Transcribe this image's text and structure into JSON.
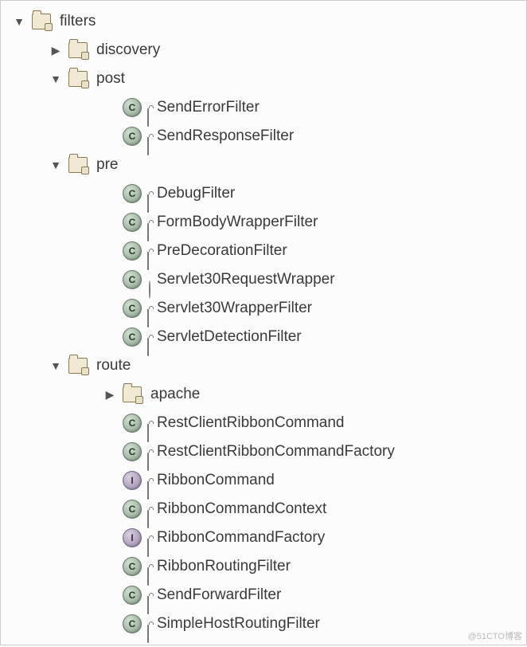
{
  "tree": {
    "root": {
      "label": "filters",
      "children": [
        {
          "label": "discovery",
          "collapsed": true
        },
        {
          "label": "post",
          "children": [
            {
              "label": "SendErrorFilter",
              "kind": "class"
            },
            {
              "label": "SendResponseFilter",
              "kind": "class"
            }
          ]
        },
        {
          "label": "pre",
          "children": [
            {
              "label": "DebugFilter",
              "kind": "class"
            },
            {
              "label": "FormBodyWrapperFilter",
              "kind": "class"
            },
            {
              "label": "PreDecorationFilter",
              "kind": "class"
            },
            {
              "label": "Servlet30RequestWrapper",
              "kind": "class",
              "vis": "default"
            },
            {
              "label": "Servlet30WrapperFilter",
              "kind": "class"
            },
            {
              "label": "ServletDetectionFilter",
              "kind": "class"
            }
          ]
        },
        {
          "label": "route",
          "children": [
            {
              "label": "apache",
              "kind": "package",
              "collapsed": true
            },
            {
              "label": "RestClientRibbonCommand",
              "kind": "class"
            },
            {
              "label": "RestClientRibbonCommandFactory",
              "kind": "class"
            },
            {
              "label": "RibbonCommand",
              "kind": "interface"
            },
            {
              "label": "RibbonCommandContext",
              "kind": "class"
            },
            {
              "label": "RibbonCommandFactory",
              "kind": "interface"
            },
            {
              "label": "RibbonRoutingFilter",
              "kind": "class"
            },
            {
              "label": "SendForwardFilter",
              "kind": "class"
            },
            {
              "label": "SimpleHostRoutingFilter",
              "kind": "class"
            }
          ]
        }
      ]
    }
  },
  "watermark": "@51CTO博客"
}
